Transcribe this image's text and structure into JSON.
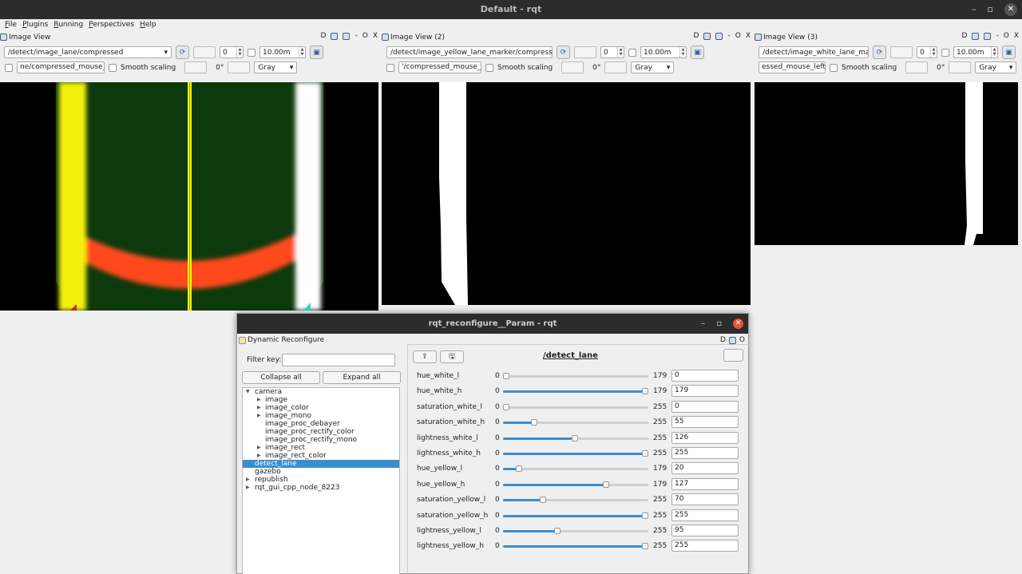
{
  "window": {
    "title": "Default - rqt",
    "minimize": "–",
    "maximize": "▫",
    "close": "✕"
  },
  "menu": [
    "File",
    "Plugins",
    "Running",
    "Perspectives",
    "Help"
  ],
  "panes": [
    {
      "title": "Image View",
      "topic": "/detect/image_lane/compressed",
      "spin_value": "0",
      "max_value": "10.00m",
      "mouse_topic": "ne/compressed_mouse_left",
      "smooth_label": "Smooth scaling",
      "rotation": "0°",
      "color_mode": "Gray",
      "ctrl_d": "D",
      "ctrl_dash": "-",
      "ctrl_o": "O",
      "ctrl_x": "X"
    },
    {
      "title": "Image View (2)",
      "topic": "/detect/image_yellow_lane_marker/compressed",
      "spin_value": "0",
      "max_value": "10.00m",
      "mouse_topic": "'/compressed_mouse_left",
      "smooth_label": "Smooth scaling",
      "rotation": "0°",
      "color_mode": "Gray",
      "ctrl_d": "D",
      "ctrl_dash": "-",
      "ctrl_o": "O",
      "ctrl_x": "X"
    },
    {
      "title": "Image View (3)",
      "topic": "/detect/image_white_lane_mar",
      "spin_value": "0",
      "max_value": "10.00m",
      "mouse_topic": "essed_mouse_left",
      "smooth_label": "Smooth scaling",
      "rotation": "0°",
      "color_mode": "Gray",
      "ctrl_d": "D",
      "ctrl_dash": "-",
      "ctrl_o": "O",
      "ctrl_x": "X"
    }
  ],
  "dialog": {
    "title": "rqt_reconfigure__Param - rqt",
    "min": "–",
    "max": "▫",
    "close": "✕",
    "plugin_title": "Dynamic Reconfigure",
    "ctrl_d": "D",
    "ctrl_o": "O",
    "filter_label": "Filter key:",
    "filter_value": "",
    "collapse_label": "Collapse all",
    "expand_label": "Expand all",
    "node_title": "/detect_lane",
    "tree": [
      {
        "label": "camera",
        "depth": 0,
        "arrow": "▼"
      },
      {
        "label": "image",
        "depth": 1,
        "arrow": "▶"
      },
      {
        "label": "image_color",
        "depth": 1,
        "arrow": "▶"
      },
      {
        "label": "image_mono",
        "depth": 1,
        "arrow": "▶"
      },
      {
        "label": "image_proc_debayer",
        "depth": 1,
        "arrow": ""
      },
      {
        "label": "image_proc_rectify_color",
        "depth": 1,
        "arrow": ""
      },
      {
        "label": "image_proc_rectify_mono",
        "depth": 1,
        "arrow": ""
      },
      {
        "label": "image_rect",
        "depth": 1,
        "arrow": "▶"
      },
      {
        "label": "image_rect_color",
        "depth": 1,
        "arrow": "▶"
      },
      {
        "label": "detect_lane",
        "depth": 0,
        "arrow": "",
        "selected": true
      },
      {
        "label": "gazebo",
        "depth": 0,
        "arrow": ""
      },
      {
        "label": "republish",
        "depth": 0,
        "arrow": "▶"
      },
      {
        "label": "rqt_gui_cpp_node_8223",
        "depth": 0,
        "arrow": "▶"
      }
    ],
    "params": [
      {
        "name": "hue_white_l",
        "min": "0",
        "max": "179",
        "value": "0",
        "frac": 0.0
      },
      {
        "name": "hue_white_h",
        "min": "0",
        "max": "179",
        "value": "179",
        "frac": 1.0
      },
      {
        "name": "saturation_white_l",
        "min": "0",
        "max": "255",
        "value": "0",
        "frac": 0.0
      },
      {
        "name": "saturation_white_h",
        "min": "0",
        "max": "255",
        "value": "55",
        "frac": 0.2157
      },
      {
        "name": "lightness_white_l",
        "min": "0",
        "max": "255",
        "value": "126",
        "frac": 0.4941
      },
      {
        "name": "lightness_white_h",
        "min": "0",
        "max": "255",
        "value": "255",
        "frac": 1.0
      },
      {
        "name": "hue_yellow_l",
        "min": "0",
        "max": "179",
        "value": "20",
        "frac": 0.1117
      },
      {
        "name": "hue_yellow_h",
        "min": "0",
        "max": "179",
        "value": "127",
        "frac": 0.7095
      },
      {
        "name": "saturation_yellow_l",
        "min": "0",
        "max": "255",
        "value": "70",
        "frac": 0.2745
      },
      {
        "name": "saturation_yellow_h",
        "min": "0",
        "max": "255",
        "value": "255",
        "frac": 1.0
      },
      {
        "name": "lightness_yellow_l",
        "min": "0",
        "max": "255",
        "value": "95",
        "frac": 0.3725
      },
      {
        "name": "lightness_yellow_h",
        "min": "0",
        "max": "255",
        "value": "255",
        "frac": 1.0
      }
    ]
  },
  "colors": {
    "accent": "#3a8ed0",
    "lane_bg": "#0d3a0d",
    "yellow": "#f4f00a",
    "red": "#ff4a1a"
  }
}
